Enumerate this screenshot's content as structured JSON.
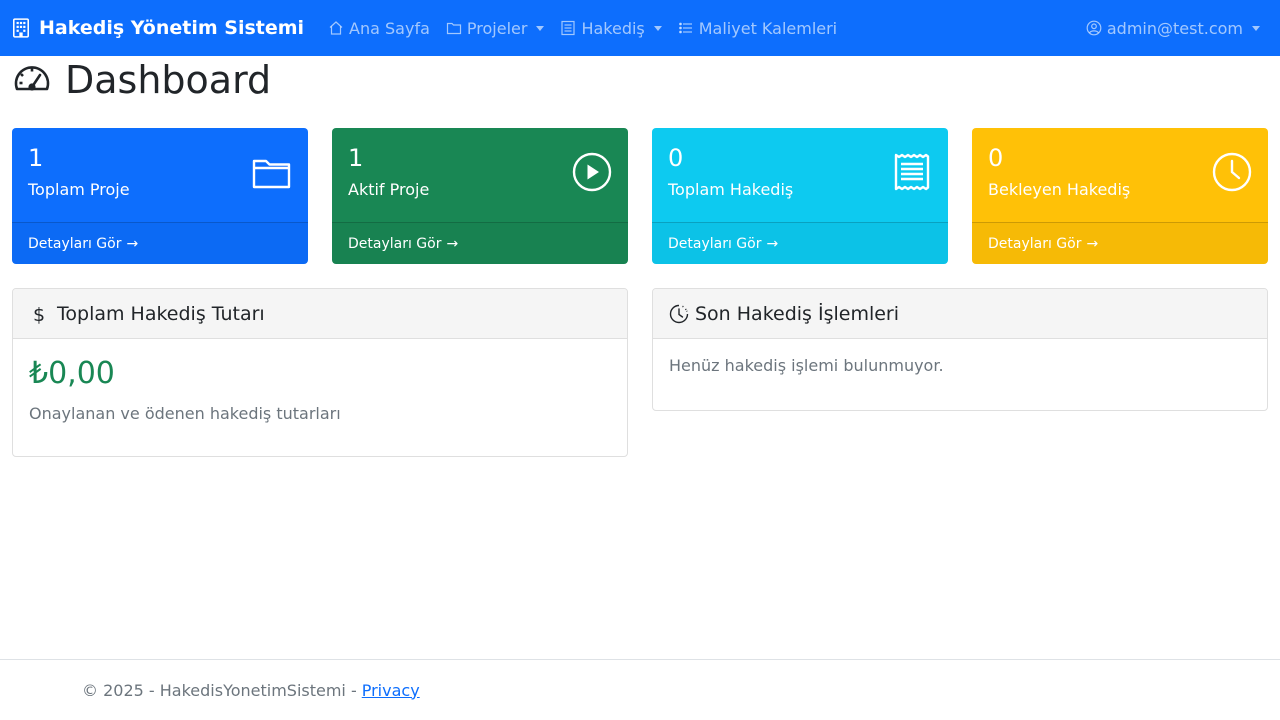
{
  "navbar": {
    "brand": "Hakediş Yönetim Sistemi",
    "items": [
      {
        "label": "Ana Sayfa",
        "icon": "house-icon"
      },
      {
        "label": "Projeler",
        "icon": "folder-icon"
      },
      {
        "label": "Hakediş",
        "icon": "receipt-icon"
      },
      {
        "label": "Maliyet Kalemleri",
        "icon": "list-icon"
      }
    ],
    "user": "admin@test.com"
  },
  "page": {
    "title": "Dashboard"
  },
  "stats": [
    {
      "value": "1",
      "label": "Toplam Proje",
      "link": "Detayları Gör",
      "icon": "folder-icon",
      "color": "#0d6efd"
    },
    {
      "value": "1",
      "label": "Aktif Proje",
      "link": "Detayları Gör",
      "icon": "play-circle-icon",
      "color": "#198754"
    },
    {
      "value": "0",
      "label": "Toplam Hakediş",
      "link": "Detayları Gör",
      "icon": "receipt-icon",
      "color": "#0dcaf0"
    },
    {
      "value": "0",
      "label": "Bekleyen Hakediş",
      "link": "Detayları Gör",
      "icon": "clock-icon",
      "color": "#ffc107"
    }
  ],
  "total_card": {
    "icon_glyph": "$",
    "title": "Toplam Hakediş Tutarı",
    "amount": "₺0,00",
    "note": "Onaylanan ve ödenen hakediş tutarları"
  },
  "recent_card": {
    "title": "Son Hakediş İşlemleri",
    "empty": "Henüz hakediş işlemi bulunmuyor."
  },
  "footer": {
    "text": "© 2025 - HakedisYonetimSistemi -",
    "link": "Privacy"
  },
  "arrow_glyph": "→",
  "colors": {
    "primary": "#0d6efd",
    "success": "#198754",
    "info": "#0dcaf0",
    "warning": "#ffc107",
    "muted": "#6c757d"
  }
}
